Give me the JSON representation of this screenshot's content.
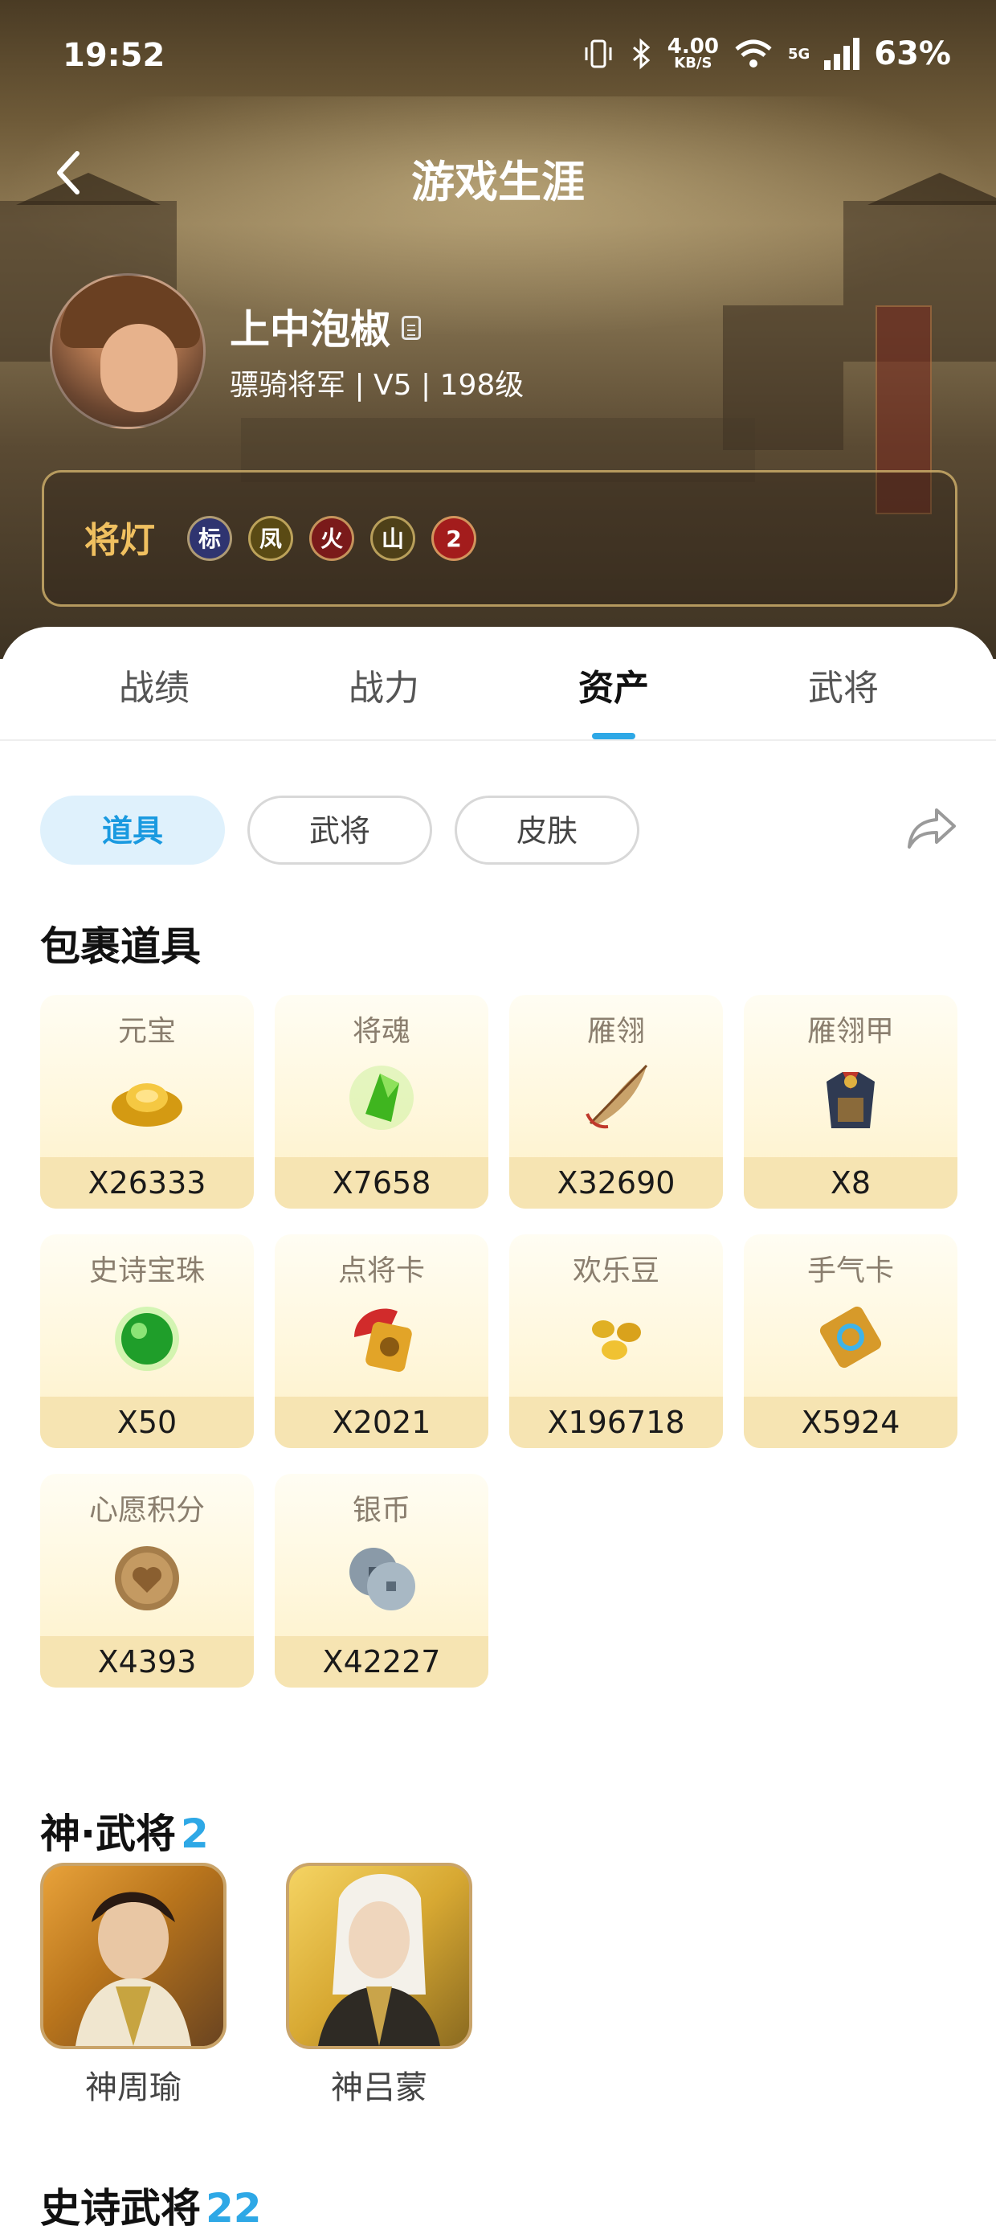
{
  "status_bar": {
    "time": "19:52",
    "net_speed": "4.00",
    "net_unit": "KB/S",
    "network": "5G",
    "battery": "63%"
  },
  "header": {
    "title": "游戏生涯"
  },
  "profile": {
    "name": "上中泡椒",
    "rank_line": "骠骑将军 | V5 | 198级"
  },
  "lamps": {
    "label": "将灯",
    "items": [
      {
        "glyph": "标",
        "icon": "biao-lamp-badge",
        "color": "#3b3f8a"
      },
      {
        "glyph": "凤",
        "icon": "feng-lamp-badge",
        "color": "#6b5a18"
      },
      {
        "glyph": "火",
        "icon": "huo-lamp-badge",
        "color": "#8a1e1e"
      },
      {
        "glyph": "山",
        "icon": "shan-lamp-badge",
        "color": "#5a4a1e"
      },
      {
        "glyph": "2",
        "icon": "two-lamp-badge",
        "color": "#b01f1f"
      }
    ]
  },
  "tabs": {
    "items": [
      "战绩",
      "战力",
      "资产",
      "武将"
    ],
    "active": "资产"
  },
  "filters": {
    "items": [
      "道具",
      "武将",
      "皮肤"
    ],
    "active": "道具"
  },
  "inventory": {
    "title": "包裹道具",
    "items": [
      {
        "name": "元宝",
        "qty": "X26333",
        "icon": "gold-ingot-icon"
      },
      {
        "name": "将魂",
        "qty": "X7658",
        "icon": "green-crystal-icon"
      },
      {
        "name": "雁翎",
        "qty": "X32690",
        "icon": "feather-icon"
      },
      {
        "name": "雁翎甲",
        "qty": "X8",
        "icon": "armor-icon"
      },
      {
        "name": "史诗宝珠",
        "qty": "X50",
        "icon": "green-orb-icon"
      },
      {
        "name": "点将卡",
        "qty": "X2021",
        "icon": "general-card-icon"
      },
      {
        "name": "欢乐豆",
        "qty": "X196718",
        "icon": "gold-beans-icon"
      },
      {
        "name": "手气卡",
        "qty": "X5924",
        "icon": "luck-card-icon"
      },
      {
        "name": "心愿积分",
        "qty": "X4393",
        "icon": "heart-coin-icon"
      },
      {
        "name": "银币",
        "qty": "X42227",
        "icon": "silver-coin-icon"
      }
    ]
  },
  "divine_generals": {
    "title": "神·武将",
    "count": "2",
    "items": [
      {
        "name": "神周瑜",
        "icon": "zhouyu-portrait"
      },
      {
        "name": "神吕蒙",
        "icon": "lvmeng-portrait"
      }
    ]
  },
  "epic_generals": {
    "title": "史诗武将",
    "count": "22"
  }
}
